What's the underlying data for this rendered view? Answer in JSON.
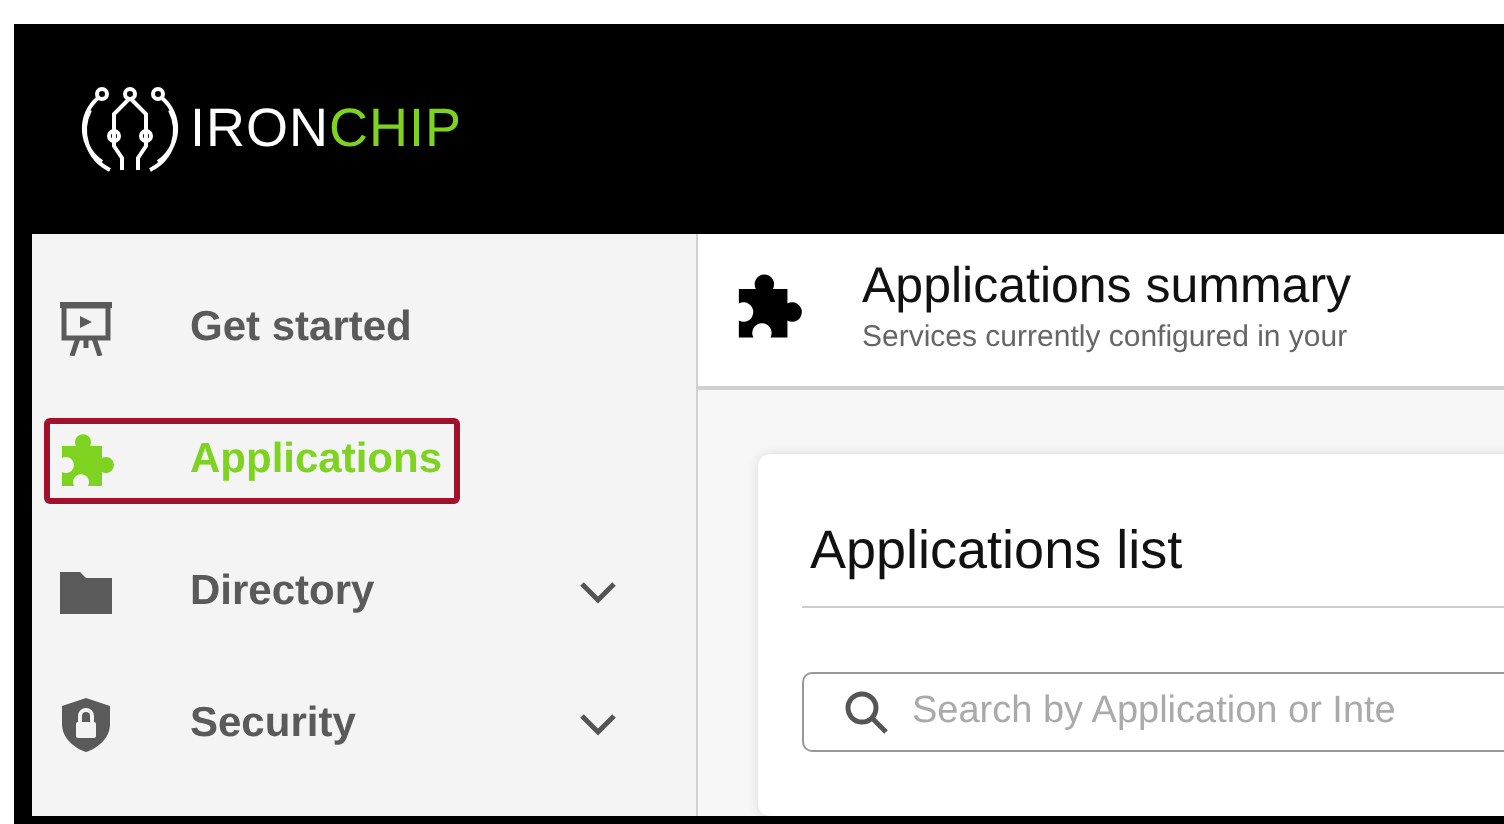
{
  "logo": {
    "brand": "IRON",
    "brand_accent": "CHIP"
  },
  "sidebar": {
    "items": [
      {
        "label": "Get started",
        "kind": "link",
        "selected": false
      },
      {
        "label": "Applications",
        "kind": "link",
        "selected": true
      },
      {
        "label": "Directory",
        "kind": "group",
        "selected": false
      },
      {
        "label": "Security",
        "kind": "group",
        "selected": false
      }
    ]
  },
  "page_header": {
    "title": "Applications summary",
    "subtitle": "Services currently configured in your"
  },
  "card": {
    "title": "Applications list",
    "search": {
      "placeholder": "Search by Application or Inte"
    }
  }
}
